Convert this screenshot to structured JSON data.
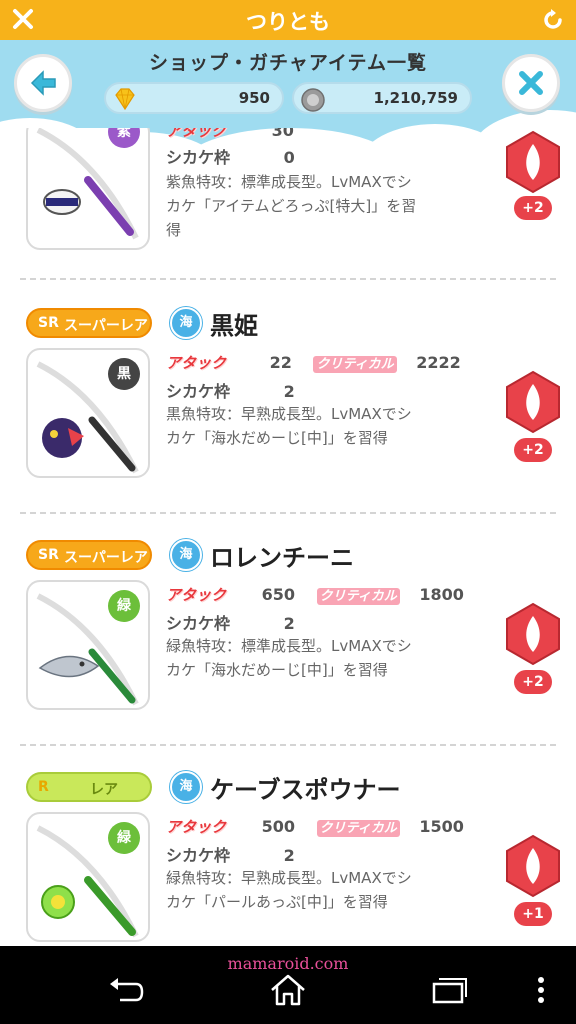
{
  "app_title": "つりとも",
  "header": {
    "title": "ショップ・ガチャアイテム一覧",
    "gems": "950",
    "coins": "1,210,759"
  },
  "labels": {
    "attack": "アタック",
    "critical": "クリティカル",
    "shikake": "シカケ枠",
    "sea": "海"
  },
  "colors": {
    "title_bar": "#f7b21a",
    "header_bg": "#9fdcf0",
    "sr_badge": "#f7a81a",
    "r_badge": "#c9e85a",
    "red": "#e8383d"
  },
  "items": [
    {
      "attack": "30",
      "shikake": "0",
      "color_label": "紫",
      "color_hex": "#9b59c9",
      "desc_line1": "紫魚特攻：標準成長型。LvMAXでシ",
      "desc_line2": "カケ「アイテムどろっぷ[特大]」を習",
      "desc_line3": "得",
      "plus": "+2"
    },
    {
      "rarity_tag": "SR",
      "rarity_name": "スーパーレア",
      "name": "黒姫",
      "attack": "22",
      "critical": "2222",
      "shikake": "2",
      "color_label": "黒",
      "color_hex": "#444444",
      "desc_line1": "黒魚特攻：早熟成長型。LvMAXでシ",
      "desc_line2": "カケ「海水だめーじ[中]」を習得",
      "plus": "+2"
    },
    {
      "rarity_tag": "SR",
      "rarity_name": "スーパーレア",
      "name": "ロレンチーニ",
      "attack": "650",
      "critical": "1800",
      "shikake": "2",
      "color_label": "緑",
      "color_hex": "#6cbf3a",
      "desc_line1": "緑魚特攻：標準成長型。LvMAXでシ",
      "desc_line2": "カケ「海水だめーじ[中]」を習得",
      "plus": "+2"
    },
    {
      "rarity_tag": "R",
      "rarity_name": "レア",
      "name": "ケーブスポウナー",
      "attack": "500",
      "critical": "1500",
      "shikake": "2",
      "color_label": "緑",
      "color_hex": "#6cbf3a",
      "desc_line1": "緑魚特攻：早熟成長型。LvMAXでシ",
      "desc_line2": "カケ「パールあっぷ[中]」を習得",
      "plus": "+1"
    }
  ],
  "watermark": "mamaroid.com"
}
